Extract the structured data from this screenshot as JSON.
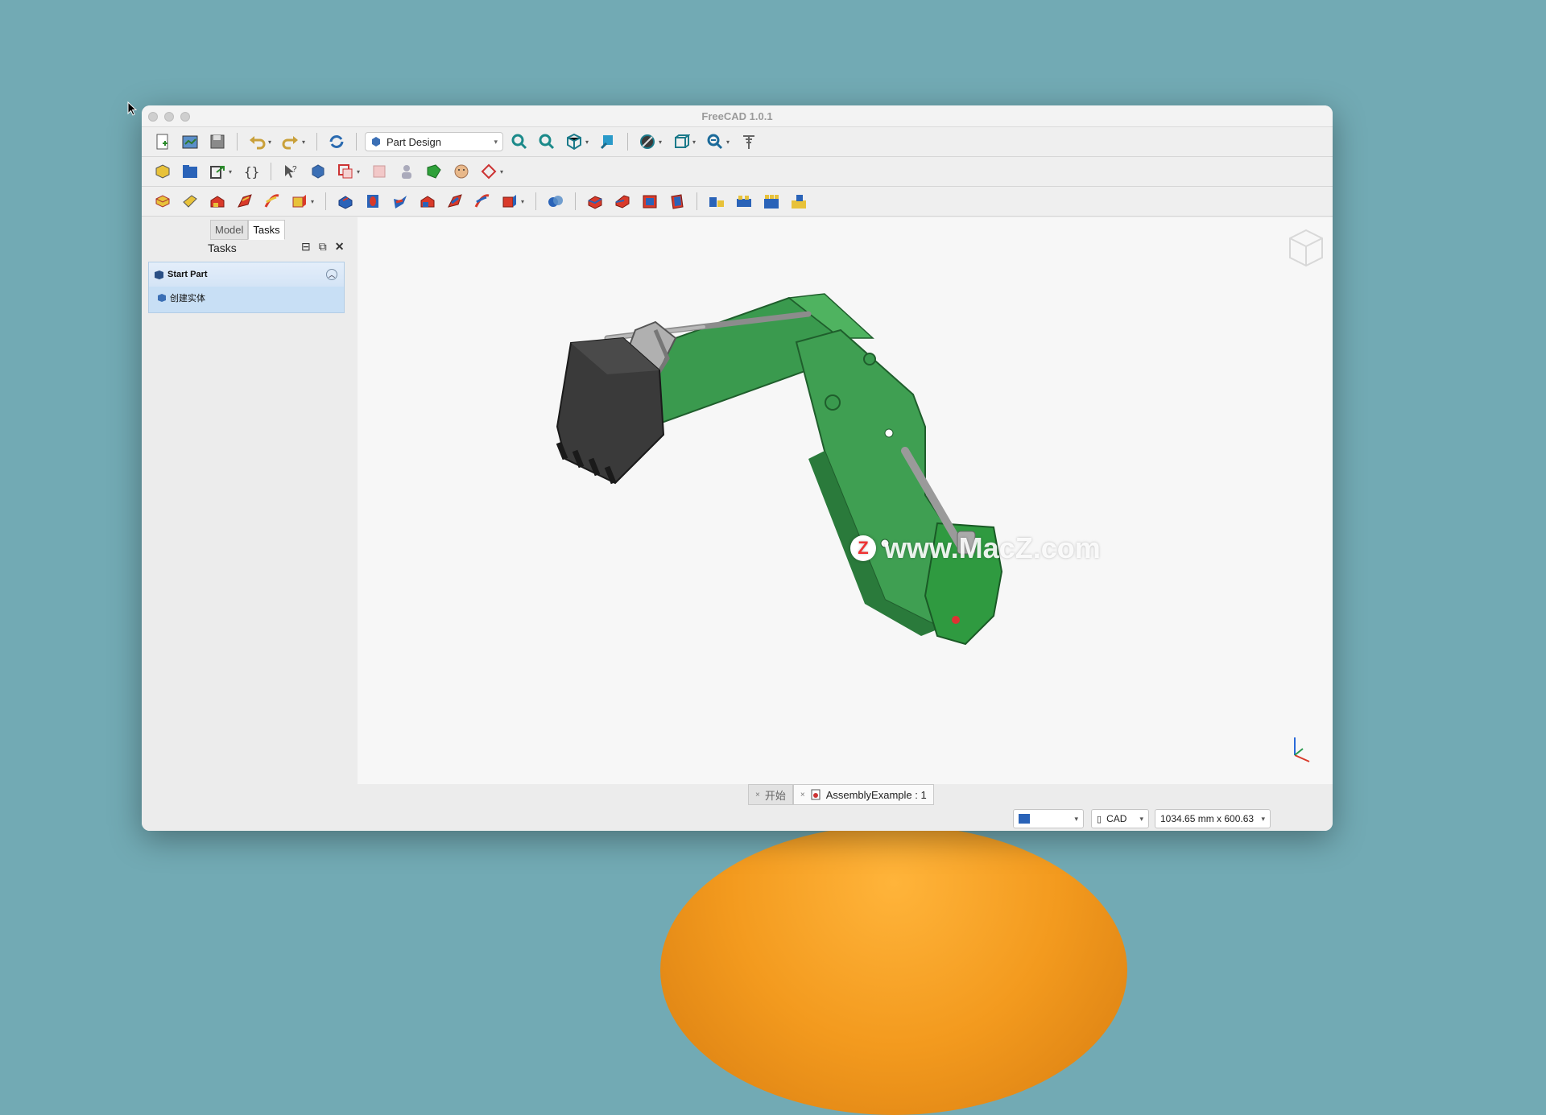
{
  "window": {
    "title": "FreeCAD 1.0.1"
  },
  "toolbar1": {
    "workbench": "Part Design",
    "icons": [
      "new-document-icon",
      "open-icon",
      "save-icon",
      "undo-icon",
      "redo-icon",
      "refresh-icon",
      "fit-all-icon",
      "fit-selection-icon",
      "standard-views-icon",
      "measure-icon",
      "draw-style-icon",
      "view-box-icon",
      "zoom-icon",
      "tools-icon"
    ]
  },
  "left_panel": {
    "tabs": [
      "Model",
      "Tasks"
    ],
    "active_tab": "Tasks",
    "header": "Tasks",
    "task_group": {
      "title": "Start Part",
      "item": "创建实体"
    }
  },
  "viewport": {
    "watermark": "www.MacZ.com",
    "watermark_letter": "Z"
  },
  "doc_tabs": [
    {
      "label": "开始",
      "active": false
    },
    {
      "label": "AssemblyExample : 1",
      "active": true
    }
  ],
  "statusbar": {
    "navigation": "CAD",
    "dimensions": "1034.65 mm x 600.63 mm"
  },
  "colors": {
    "accent_green": "#3a9a4e",
    "bucket": "#3a3a3a",
    "task_blue": "#c8dff5"
  }
}
